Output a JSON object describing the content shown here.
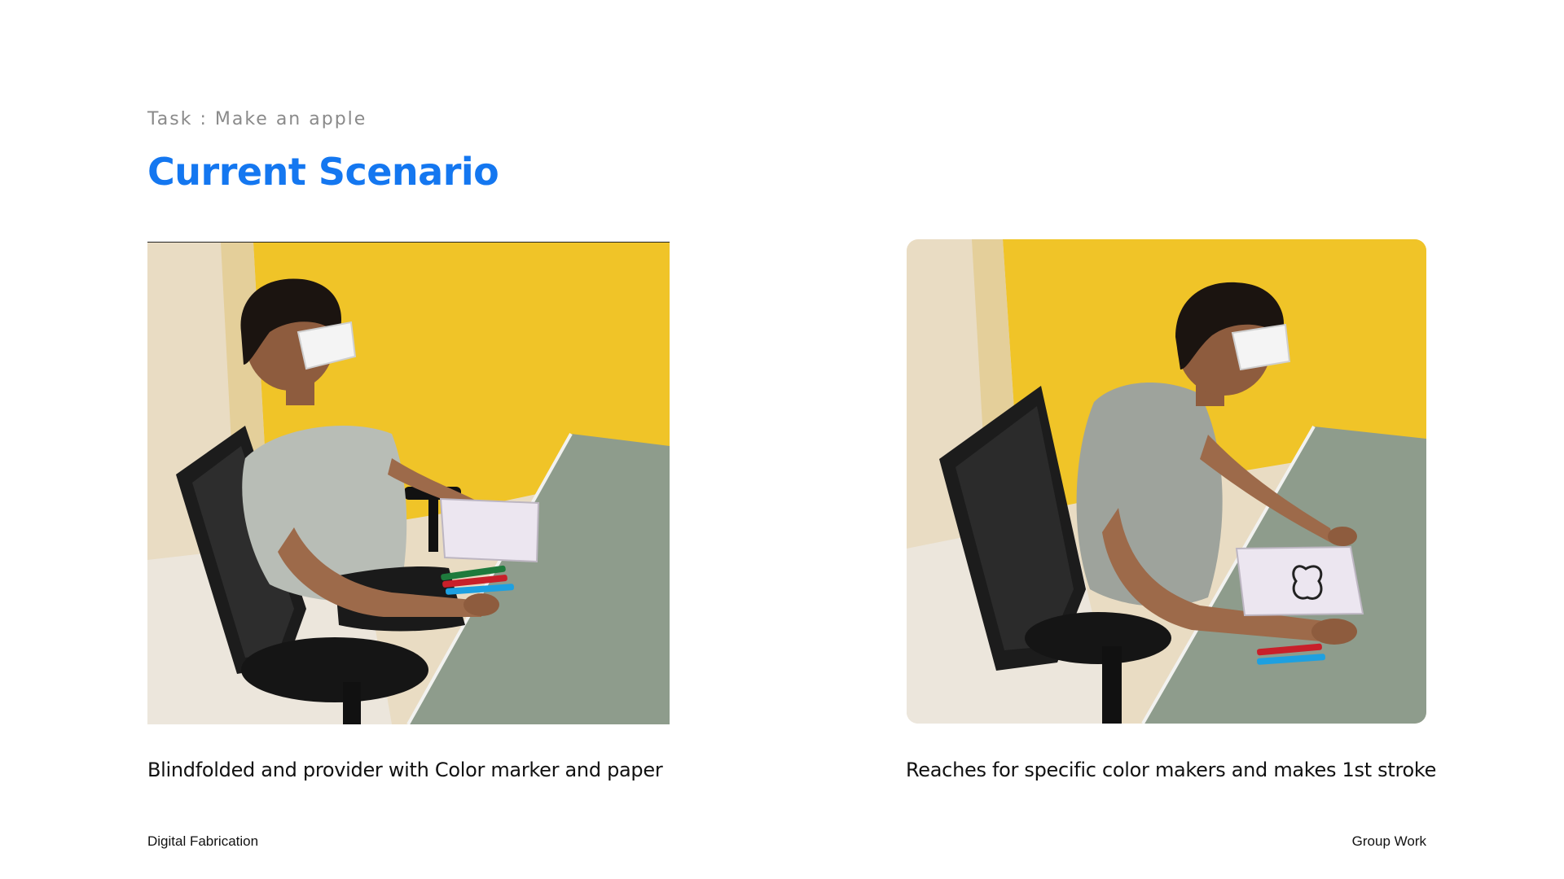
{
  "header": {
    "task_label": "Task : Make an apple",
    "title": "Current Scenario"
  },
  "photos": [
    {
      "caption": "Blindfolded and provider with Color marker and paper"
    },
    {
      "caption": "Reaches for specific color makers and makes 1st stroke"
    }
  ],
  "footer": {
    "left": "Digital Fabrication",
    "right": "Group Work"
  },
  "colors": {
    "title": "#1477f0",
    "wall_yellow": "#f0c428",
    "desk_green": "#8e9c8c"
  }
}
